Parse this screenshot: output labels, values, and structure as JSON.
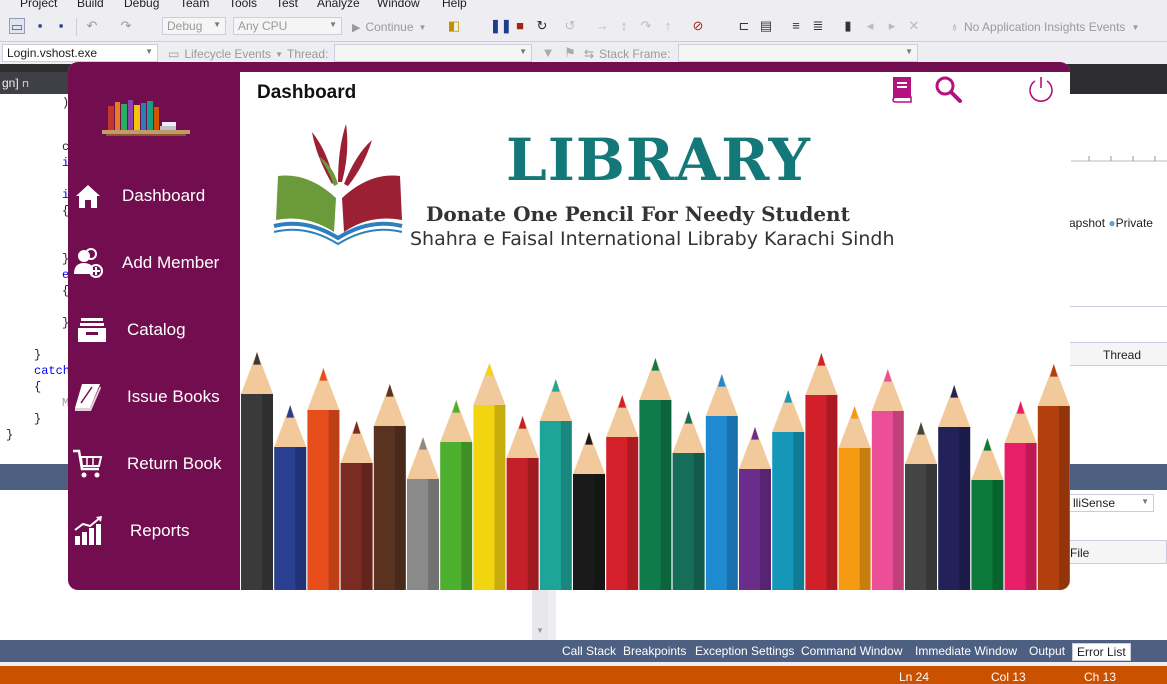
{
  "vs": {
    "menu": [
      "Project",
      "Build",
      "Debug",
      "Team",
      "Tools",
      "Test",
      "Analyze",
      "Window",
      "Help"
    ],
    "toolbar": {
      "config": "Debug",
      "platform": "Any CPU",
      "continue": "Continue",
      "insights": "No Application Insights Events"
    },
    "toolbar2": {
      "process": "Login.vshost.exe",
      "lifecycle": "Lifecycle Events",
      "thread_label": "Thread:",
      "stack_frame_label": "Stack Frame:"
    },
    "doc_tab": "gn]",
    "code": {
      "lines": [
        "c",
        "i",
        "i",
        "{",
        "}",
        "e",
        "{",
        "}",
        "}",
        "catch",
        "{",
        "M",
        "}",
        "}"
      ]
    },
    "right_panel": {
      "snapshot": "apshot",
      "private": "Private",
      "thread": "Thread"
    },
    "lower": {
      "intellisense": "lliSense",
      "file": "File"
    },
    "bottom_tabs": [
      "Call Stack",
      "Breakpoints",
      "Exception Settings",
      "Command Window",
      "Immediate Window",
      "Output",
      "Error List"
    ],
    "status": {
      "ln": "Ln 24",
      "col": "Col 13",
      "ch": "Ch 13"
    },
    "colors": {
      "status_bar": "#ca5100",
      "tool_window_bar": "#4d6082"
    }
  },
  "app": {
    "page_title": "Dashboard",
    "nav": [
      {
        "label": "Dashboard",
        "icon": "home-icon"
      },
      {
        "label": "Add Member",
        "icon": "add-member-icon"
      },
      {
        "label": "Catalog",
        "icon": "catalog-tray-icon"
      },
      {
        "label": "Issue Books",
        "icon": "book-icon"
      },
      {
        "label": "Return Book",
        "icon": "cart-icon"
      },
      {
        "label": "Reports",
        "icon": "bar-chart-icon"
      }
    ],
    "header_icons": [
      "book-icon",
      "search-icon",
      "power-icon"
    ],
    "hero": {
      "title": "LIBRARY",
      "tagline": "Donate One Pencil For Needy Student",
      "address": "Shahra e Faisal International Libraby Karachi Sindh"
    },
    "colors": {
      "sidebar": "#720e4f",
      "accent_icon": "#b5127f",
      "title_teal": "#137877"
    }
  }
}
